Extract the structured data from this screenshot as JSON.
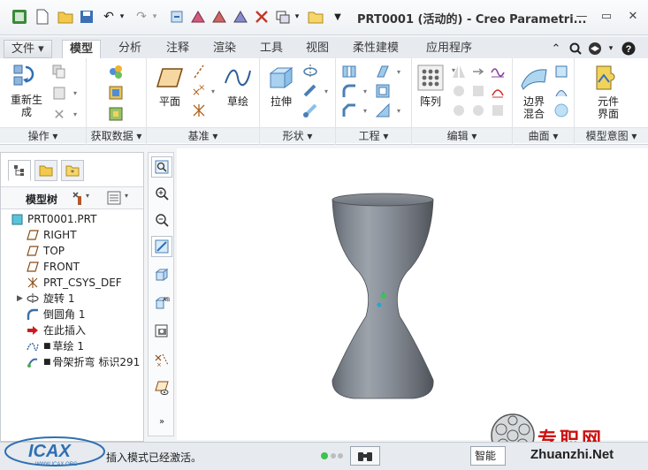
{
  "window": {
    "title": "PRT0001 (活动的) - Creo Parametri...",
    "minimize": "—",
    "restore": "▭",
    "close": "✕"
  },
  "tabs": {
    "file": "文件 ▾",
    "model": "模型",
    "analysis": "分析",
    "annotate": "注释",
    "render": "渲染",
    "tools": "工具",
    "view": "视图",
    "flexible": "柔性建模",
    "apps": "应用程序"
  },
  "ribbon": {
    "regenerate": "重新生成",
    "plane": "平面",
    "sketch": "草绘",
    "extrude": "拉伸",
    "pattern": "阵列",
    "boundary_blend": "边界混合",
    "component_interface": "元件界面",
    "groups": {
      "operations": "操作 ▾",
      "get_data": "获取数据 ▾",
      "datum": "基准 ▾",
      "shapes": "形状 ▾",
      "engineering": "工程 ▾",
      "editing": "编辑 ▾",
      "surfaces": "曲面 ▾",
      "model_intent": "模型意图 ▾"
    }
  },
  "panel": {
    "tree_label": "模型树",
    "items": [
      {
        "label": "PRT0001.PRT",
        "icon": "part-icon"
      },
      {
        "label": "RIGHT",
        "icon": "datum-plane-icon"
      },
      {
        "label": "TOP",
        "icon": "datum-plane-icon"
      },
      {
        "label": "FRONT",
        "icon": "datum-plane-icon"
      },
      {
        "label": "PRT_CSYS_DEF",
        "icon": "csys-icon"
      },
      {
        "label": "旋转 1",
        "icon": "revolve-icon"
      },
      {
        "label": "倒圆角 1",
        "icon": "round-icon"
      },
      {
        "label": "在此插入",
        "icon": "insert-here-icon"
      },
      {
        "label": "草绘 1",
        "icon": "sketch-icon"
      },
      {
        "label": "骨架折弯 标识291",
        "icon": "spinal-bend-icon"
      }
    ]
  },
  "status": {
    "message": "插入模式已经激活。",
    "smart": "智能"
  },
  "watermark": {
    "site_cn": "专职网",
    "site_en": "Zhuanzhi.Net",
    "left_logo": "ICAX",
    "left_url": "WWW.ICAX.ORG"
  },
  "colors": {
    "accent": "#2f6fb3",
    "model_gray": "#8a9099"
  }
}
